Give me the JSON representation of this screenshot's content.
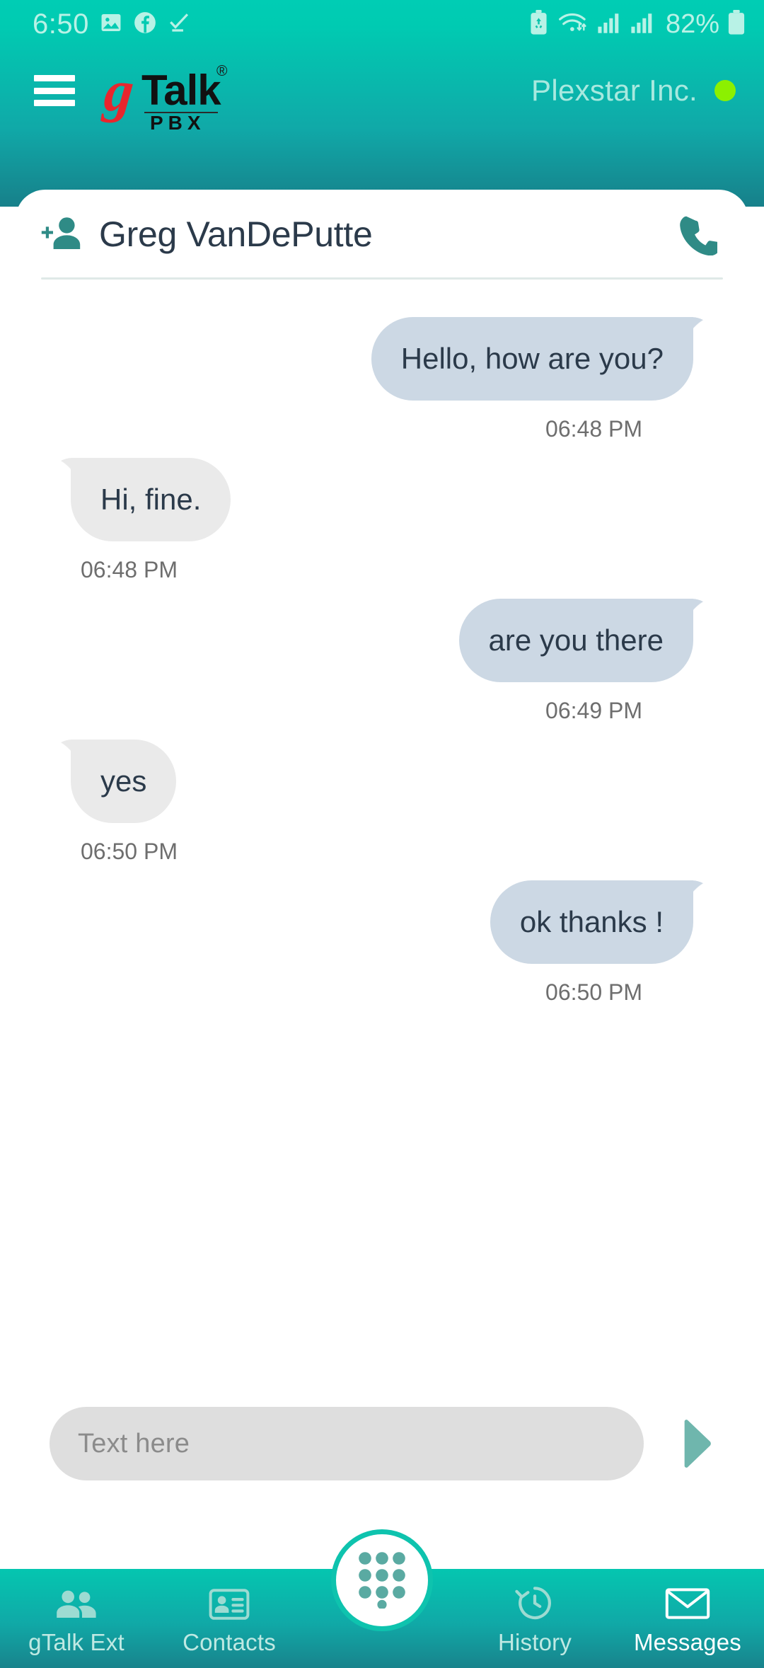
{
  "status_bar": {
    "time": "6:50",
    "battery_percent": "82%",
    "icons": [
      "gallery-icon",
      "facebook-icon",
      "check-download-icon",
      "battery-saver-icon",
      "wifi-icon",
      "signal-bars-icon-1",
      "signal-bars-icon-2",
      "battery-icon"
    ]
  },
  "app_bar": {
    "menu_icon": "hamburger-menu-icon",
    "logo": {
      "g": "g",
      "talk": "Talk",
      "registered": "®",
      "pbx": "PBX"
    },
    "company_name": "Plexstar Inc.",
    "presence_color": "#8cf000"
  },
  "conversation": {
    "contact_name": "Greg VanDePutte",
    "add_contact_icon": "add-person-icon",
    "call_icon": "phone-call-icon",
    "messages": [
      {
        "text": "Hello, how are you?",
        "time": "06:48 PM",
        "direction": "out"
      },
      {
        "text": "Hi, fine.",
        "time": "06:48 PM",
        "direction": "in"
      },
      {
        "text": "are you there",
        "time": "06:49 PM",
        "direction": "out"
      },
      {
        "text": "yes",
        "time": "06:50 PM",
        "direction": "in"
      },
      {
        "text": "ok thanks !",
        "time": "06:50 PM",
        "direction": "out"
      }
    ]
  },
  "composer": {
    "placeholder": "Text here",
    "value": "",
    "send_icon": "send-arrow-icon"
  },
  "bottom_nav": {
    "items": [
      {
        "label": "gTalk Ext",
        "icon": "people-icon",
        "active": false
      },
      {
        "label": "Contacts",
        "icon": "contact-card-icon",
        "active": false
      },
      {
        "label": "History",
        "icon": "history-clock-icon",
        "active": false
      },
      {
        "label": "Messages",
        "icon": "envelope-icon",
        "active": true
      }
    ],
    "fab_icon": "dialpad-icon"
  },
  "colors": {
    "header_top": "#00cdb4",
    "header_bottom": "#17808a",
    "accent_teal": "#2f8b86",
    "bubble_out": "#ccd8e4",
    "bubble_in": "#eaeaea",
    "text_dark": "#2b3a4a"
  }
}
